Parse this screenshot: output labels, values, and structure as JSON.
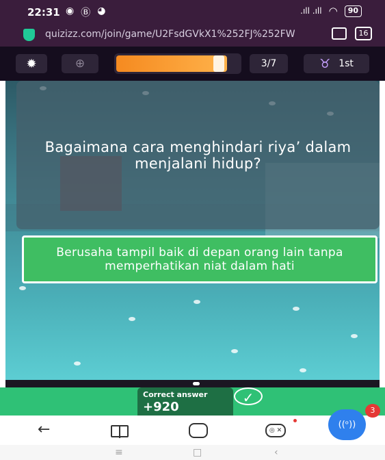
{
  "status_bar": {
    "time": "22:31",
    "left_icons": [
      "messenger-icon",
      "b-icon",
      "pie-icon"
    ],
    "signal_text": ".ıll .ıll",
    "battery": "90"
  },
  "url_bar": {
    "url": "quizizz.com/join/game/U2FsdGVkX1%252FJ%252FW",
    "tab_count": "16"
  },
  "quiz_toolbar": {
    "question_progress": "3/7",
    "rank": "1st",
    "timer_fraction": 0.9
  },
  "question": {
    "text": "Bagaimana cara menghindari riya’ dalam menjalani hidup?"
  },
  "answer": {
    "text": "Berusaha tampil baik di depan orang lain tanpa memperhatikan niat dalam hati"
  },
  "result": {
    "label": "Correct answer",
    "points": "+920"
  },
  "fab": {
    "badge": "3",
    "label": "((ᵒ))"
  },
  "colors": {
    "top_chrome": "#3a1d3c",
    "quiz_bar": "#150d1e",
    "answer_green": "#3fbe62",
    "banner_green": "#2fc176",
    "fab_blue": "#2f80ed"
  }
}
